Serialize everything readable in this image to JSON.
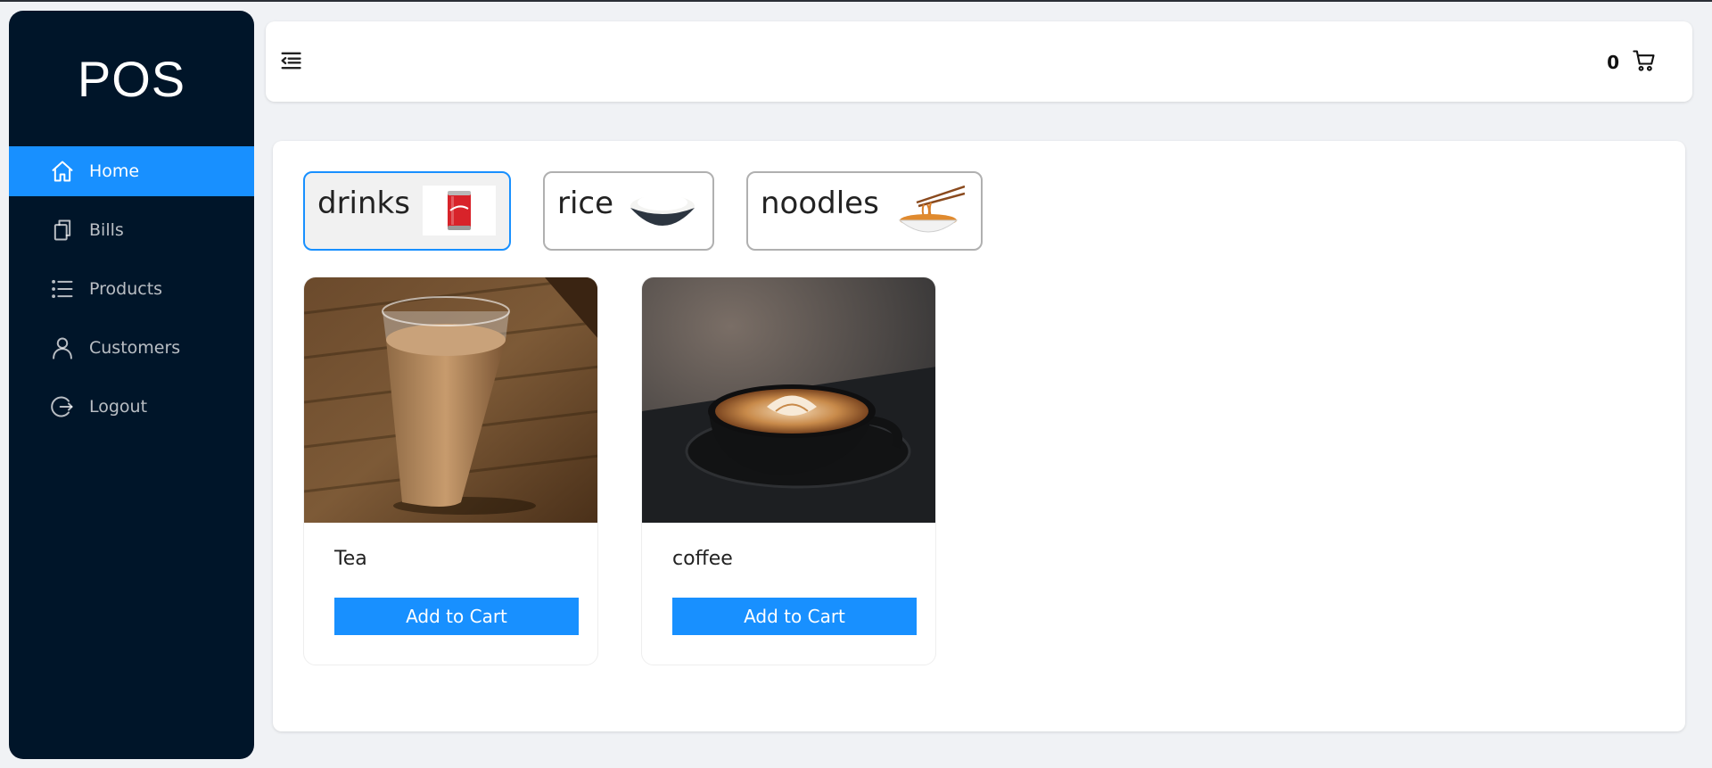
{
  "app": {
    "logo": "POS"
  },
  "sidebar": {
    "items": [
      {
        "label": "Home",
        "icon": "home-icon",
        "active": true
      },
      {
        "label": "Bills",
        "icon": "copy-icon",
        "active": false
      },
      {
        "label": "Products",
        "icon": "list-icon",
        "active": false
      },
      {
        "label": "Customers",
        "icon": "user-icon",
        "active": false
      },
      {
        "label": "Logout",
        "icon": "logout-icon",
        "active": false
      }
    ]
  },
  "header": {
    "menu_icon": "menu-fold-icon",
    "cart_count": "0",
    "cart_icon": "shopping-cart-icon"
  },
  "categories": [
    {
      "name": "drinks",
      "icon": "soda-can-image",
      "selected": true
    },
    {
      "name": "rice",
      "icon": "rice-bowl-image",
      "selected": false
    },
    {
      "name": "noodles",
      "icon": "noodle-bowl-image",
      "selected": false
    }
  ],
  "products": [
    {
      "name": "Tea",
      "image": "tea-glass-image",
      "button": "Add to Cart"
    },
    {
      "name": "coffee",
      "image": "coffee-cup-image",
      "button": "Add to Cart"
    }
  ],
  "colors": {
    "sidebar_bg": "#001529",
    "accent": "#1890ff",
    "page_bg": "#f0f2f5"
  }
}
